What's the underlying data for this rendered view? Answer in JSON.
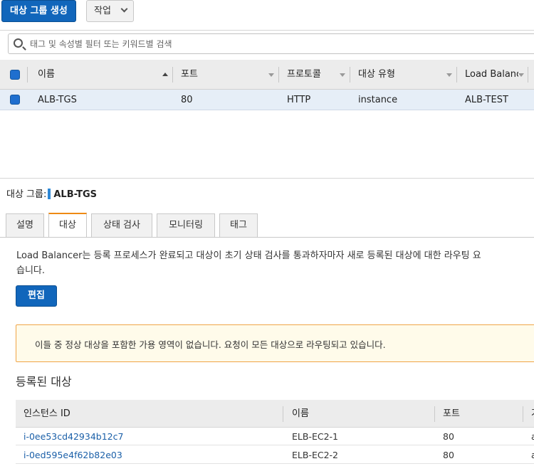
{
  "toolbar": {
    "create_button": "대상 그룹 생성",
    "actions_button": "작업"
  },
  "search": {
    "placeholder": "태그 및 속성별 필터 또는 키워드별 검색"
  },
  "target_groups_table": {
    "columns": [
      "이름",
      "포트",
      "프로토콜",
      "대상 유형",
      "Load Balanc"
    ],
    "rows": [
      {
        "name": "ALB-TGS",
        "port": "80",
        "protocol": "HTTP",
        "target_type": "instance",
        "load_balancer": "ALB-TEST"
      }
    ]
  },
  "detail": {
    "label": "대상 그룹:",
    "name": "ALB-TGS",
    "tabs": [
      "설명",
      "대상",
      "상태 검사",
      "모니터링",
      "태그"
    ],
    "active_tab": "대상",
    "description_line1": "Load Balancer는 등록 프로세스가 완료되고 대상이 초기 상태 검사를 통과하자마자 새로 등록된 대상에 대한 라우팅 요",
    "description_line2": "습니다.",
    "edit_button": "편집",
    "alert": "이들 중 정상 대상을 포함한 가용 영역이 없습니다. 요청이 모든 대상으로 라우팅되고 있습니다.",
    "registered_title": "등록된 대상",
    "registered_table": {
      "columns": [
        "인스턴스 ID",
        "이름",
        "포트",
        "가"
      ],
      "rows": [
        {
          "instance_id": "i-0ee53cd42934b12c7",
          "name": "ELB-EC2-1",
          "port": "80",
          "extra": "a"
        },
        {
          "instance_id": "i-0ed595e4f62b82e03",
          "name": "ELB-EC2-2",
          "port": "80",
          "extra": "a"
        }
      ]
    }
  },
  "colors": {
    "primary": "#1166bb",
    "active_tab_accent": "#ee8a14",
    "alert_border": "#f0a447",
    "alert_bg": "#fffbea",
    "link": "#1a5fa8",
    "selected_row": "#e6eef7"
  }
}
